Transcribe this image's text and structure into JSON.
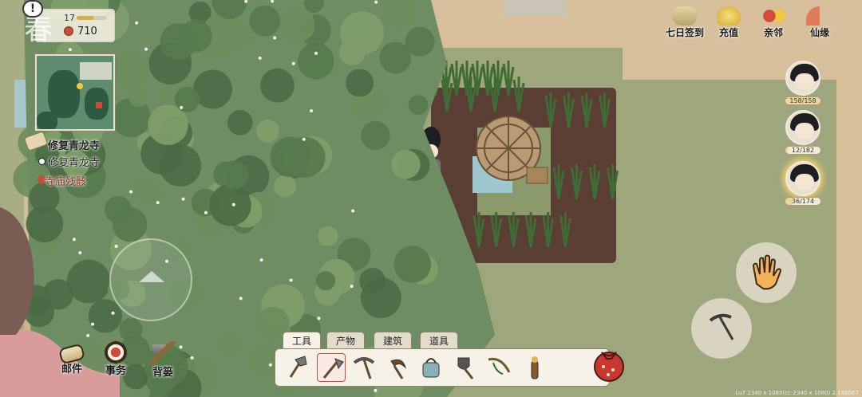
{
  "status": {
    "season": "春",
    "alert": "!",
    "level": "17",
    "exp_fraction": 0.55,
    "coins": "710"
  },
  "quests": {
    "main": "修复青龙寺",
    "sub": "修复青龙寺",
    "location": "寺庙残骸"
  },
  "top_menu": {
    "signin": "七日签到",
    "recharge": "充值",
    "neighbor": "亲邻",
    "fate": "仙缘"
  },
  "party": [
    {
      "hp": "158/158",
      "fraction": 1.0
    },
    {
      "hp": "12/182",
      "fraction": 0.066
    },
    {
      "hp": "36/174",
      "fraction": 0.207
    }
  ],
  "bottom_menu": {
    "mail": "邮件",
    "affairs": "事务",
    "bag": "背篓"
  },
  "toolbar": {
    "tabs": [
      "工具",
      "产物",
      "建筑",
      "道具"
    ],
    "active_tab": "工具",
    "tools": [
      "axe-icon",
      "hoe-icon",
      "pickaxe-icon",
      "sickle-icon",
      "watering-can-icon",
      "shovel-icon",
      "fishing-rod-icon",
      "torch-icon"
    ],
    "selected_tool": "hoe-icon"
  },
  "watermark": "Lu7 2340 x 1080(cc-2340 x 1080) 2.166667",
  "colors": {
    "grass": "#9ea67e",
    "path": "#d6bf9a",
    "soil": "#5a3d33",
    "accent_red": "#c84e3a"
  }
}
